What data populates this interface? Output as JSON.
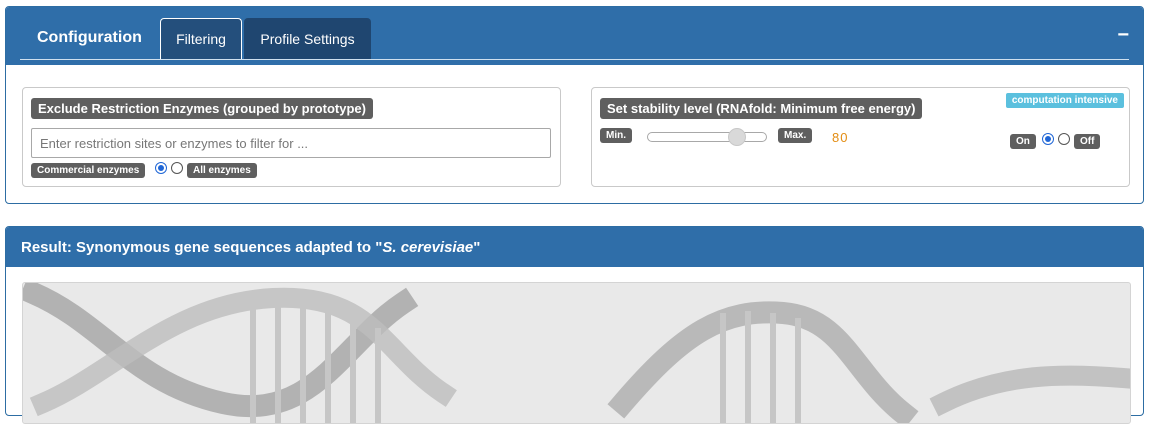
{
  "config": {
    "title": "Configuration",
    "tabs": [
      {
        "label": "Filtering",
        "active": true
      },
      {
        "label": "Profile Settings",
        "active": false
      }
    ],
    "collapse_label": "−"
  },
  "enzymes": {
    "title": "Exclude Restriction Enzymes (grouped by prototype)",
    "input_placeholder": "Enter restriction sites or enzymes to filter for ...",
    "input_value": "",
    "commercial_label": "Commercial enzymes",
    "all_label": "All enzymes",
    "selected": "commercial"
  },
  "stability": {
    "title": "Set stability level (RNAfold: Minimum free energy)",
    "badge": "computation intensive",
    "min_label": "Min.",
    "max_label": "Max.",
    "value": "80",
    "slider_fraction": 0.8,
    "on_label": "On",
    "off_label": "Off",
    "selected": "on"
  },
  "result": {
    "title_prefix": "Result: Synonymous gene sequences adapted to \"",
    "organism": "S. cerevisiae",
    "title_suffix": "\""
  },
  "colors": {
    "header_blue": "#2f6ea9",
    "tab_active": "#244f7c",
    "tab_inactive": "#1f4670",
    "label_gray": "#5f5f5f",
    "value_orange": "#e38d13",
    "badge_info": "#5bc0de"
  }
}
